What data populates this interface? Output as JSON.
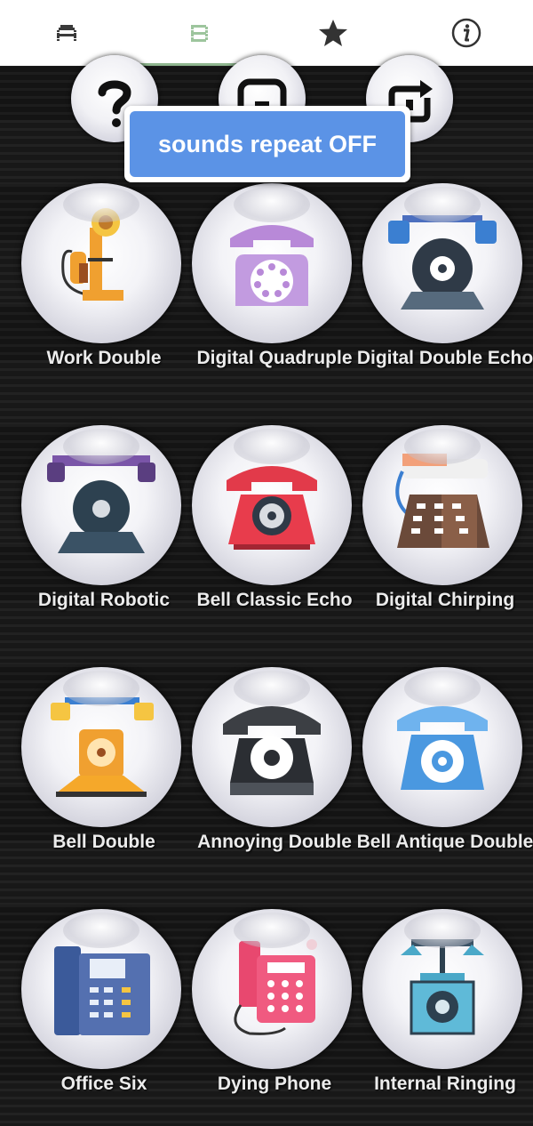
{
  "tabs": [
    {
      "icon": "letter-a-icon"
    },
    {
      "icon": "letter-b-icon"
    },
    {
      "icon": "star-icon"
    },
    {
      "icon": "info-icon"
    }
  ],
  "controls": [
    {
      "icon": "question-mark-icon"
    },
    {
      "icon": "stop-icon"
    },
    {
      "icon": "repeat-icon"
    }
  ],
  "toast": {
    "text": "sounds repeat OFF"
  },
  "sounds": [
    {
      "label": "Work Double",
      "icon": "candlestick-phone-icon"
    },
    {
      "label": "Digital Quadruple",
      "icon": "purple-rotary-phone-icon"
    },
    {
      "label": "Digital Double Echo",
      "icon": "blue-vintage-phone-icon"
    },
    {
      "label": "Digital Robotic",
      "icon": "dark-vintage-phone-icon"
    },
    {
      "label": "Bell Classic Echo",
      "icon": "red-rotary-phone-icon"
    },
    {
      "label": "Digital Chirping",
      "icon": "keypad-desk-phone-icon"
    },
    {
      "label": "Bell Double",
      "icon": "orange-antique-phone-icon"
    },
    {
      "label": "Annoying Double",
      "icon": "black-rotary-phone-icon"
    },
    {
      "label": "Bell Antique Double",
      "icon": "light-blue-rotary-phone-icon"
    },
    {
      "label": "Office Six",
      "icon": "office-phone-icon"
    },
    {
      "label": "Dying Phone",
      "icon": "pink-keypad-phone-icon"
    },
    {
      "label": "Internal Ringing",
      "icon": "wall-rotary-phone-icon"
    }
  ],
  "colors": {
    "toast": "#5b93e6",
    "tab_indicator": "#8fb68f",
    "label": "#ececec"
  }
}
